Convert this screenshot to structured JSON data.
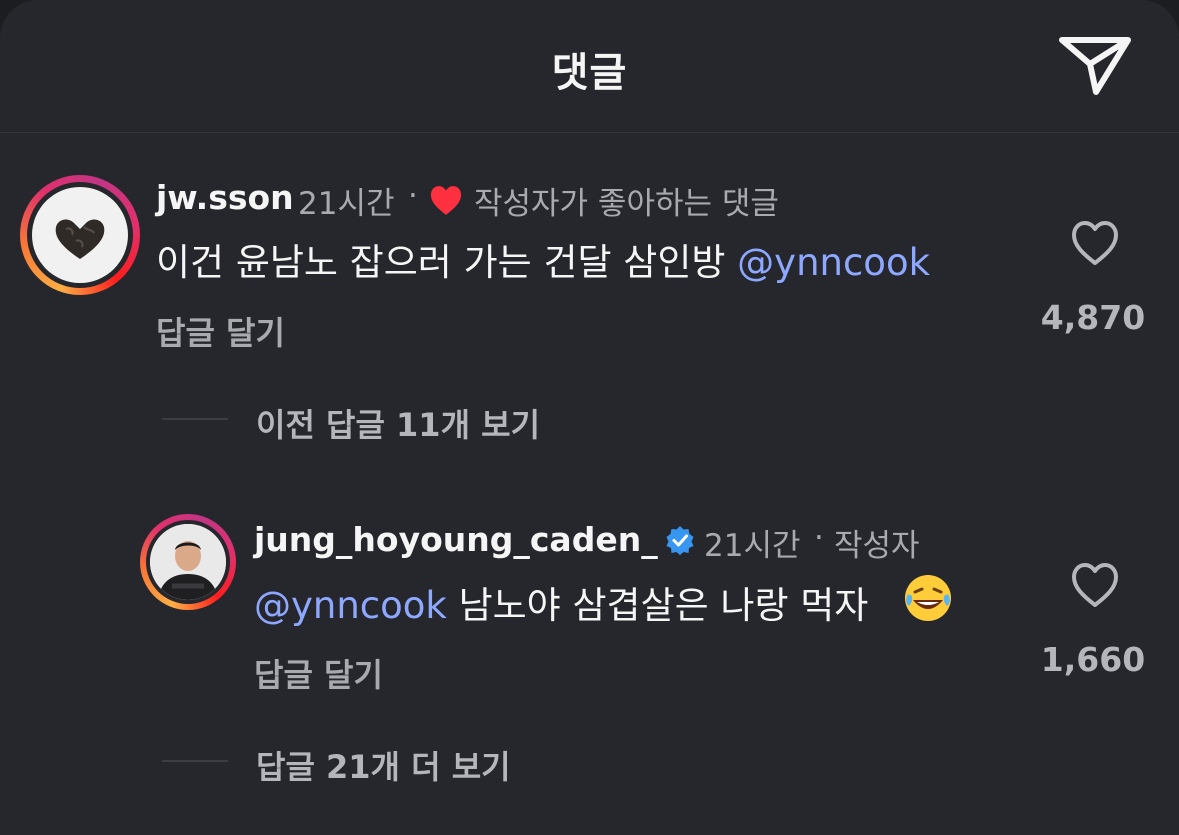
{
  "header": {
    "title": "댓글"
  },
  "comments": [
    {
      "username": "jw.sson",
      "time": "21시간",
      "separator": "·",
      "badge": "작성자가 좋아하는 댓글",
      "mention": "@ynncook",
      "text": "이건 윤남노 잡으러 가는 건달 삼인방 ",
      "reply_label": "답글 달기",
      "like_count": "4,870",
      "thread_label": "이전 답글 11개 보기"
    },
    {
      "username": "jung_hoyoung_caden_",
      "time": "21시간",
      "separator": "·",
      "author_tag": "작성자",
      "mention": "@ynncook",
      "text": " 남노야 삼겹살은 나랑 먹자",
      "emoji": "😂",
      "reply_label": "답글 달기",
      "like_count": "1,660",
      "thread_label": "답글 21개 더 보기"
    }
  ],
  "colors": {
    "background": "#25272c",
    "mention": "#8ea8ff",
    "verified": "#3797f0",
    "liked_heart": "#ff3040"
  },
  "icons": [
    "send-icon",
    "heart-outline-icon",
    "heart-filled-icon",
    "verified-badge-icon"
  ]
}
